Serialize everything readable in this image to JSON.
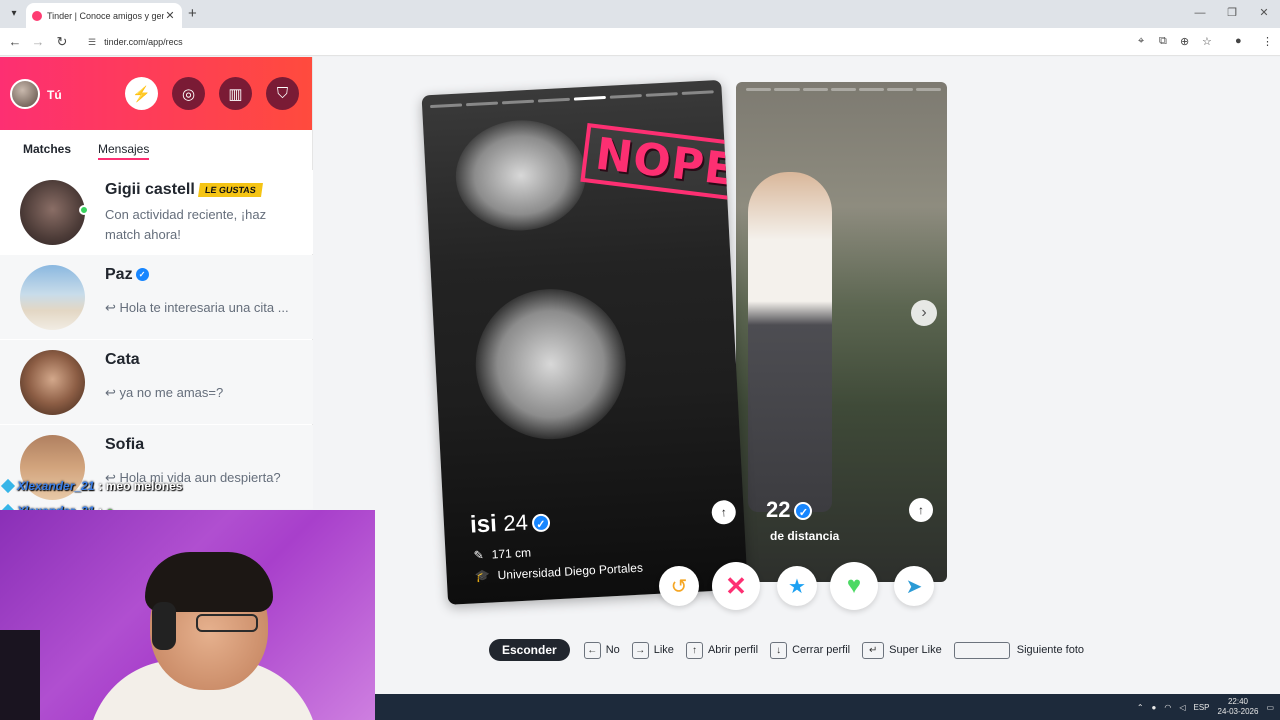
{
  "browser": {
    "tab_title": "Tinder | Conoce amigos y gente",
    "url": "tinder.com/app/recs"
  },
  "sidebar": {
    "user_name": "Tú",
    "tabs": [
      "Matches",
      "Mensajes"
    ],
    "messages": [
      {
        "name": "Gigii castell",
        "badge": "LE GUSTAS",
        "text": "Con actividad reciente, ¡haz match ahora!"
      },
      {
        "name": "Paz",
        "text": "↩ Hola te interesaria una cita ..."
      },
      {
        "name": "Cata",
        "text": "↩ ya no me amas=?"
      },
      {
        "name": "Sofia",
        "text": "↩ Hola mi vida aun despierta?"
      }
    ]
  },
  "cards": {
    "front": {
      "stamp": "NOPE",
      "name": "isi",
      "age": "24",
      "height": "171 cm",
      "school": "Universidad Diego Portales"
    },
    "back": {
      "age": "22",
      "distance": "de distancia"
    }
  },
  "hints": {
    "hide": "Esconder",
    "no": "No",
    "like": "Like",
    "open": "Abrir perfil",
    "close": "Cerrar perfil",
    "super": "Super Like",
    "next_photo": "Siguiente foto"
  },
  "stream": {
    "chat": [
      {
        "user": "Xlexander_21",
        "text": ": meo melones"
      },
      {
        "user": "Xlexander_21",
        "text": ":"
      }
    ]
  },
  "taskbar": {
    "lang": "ESP",
    "time": "22:40",
    "date": "24-03-2026"
  }
}
